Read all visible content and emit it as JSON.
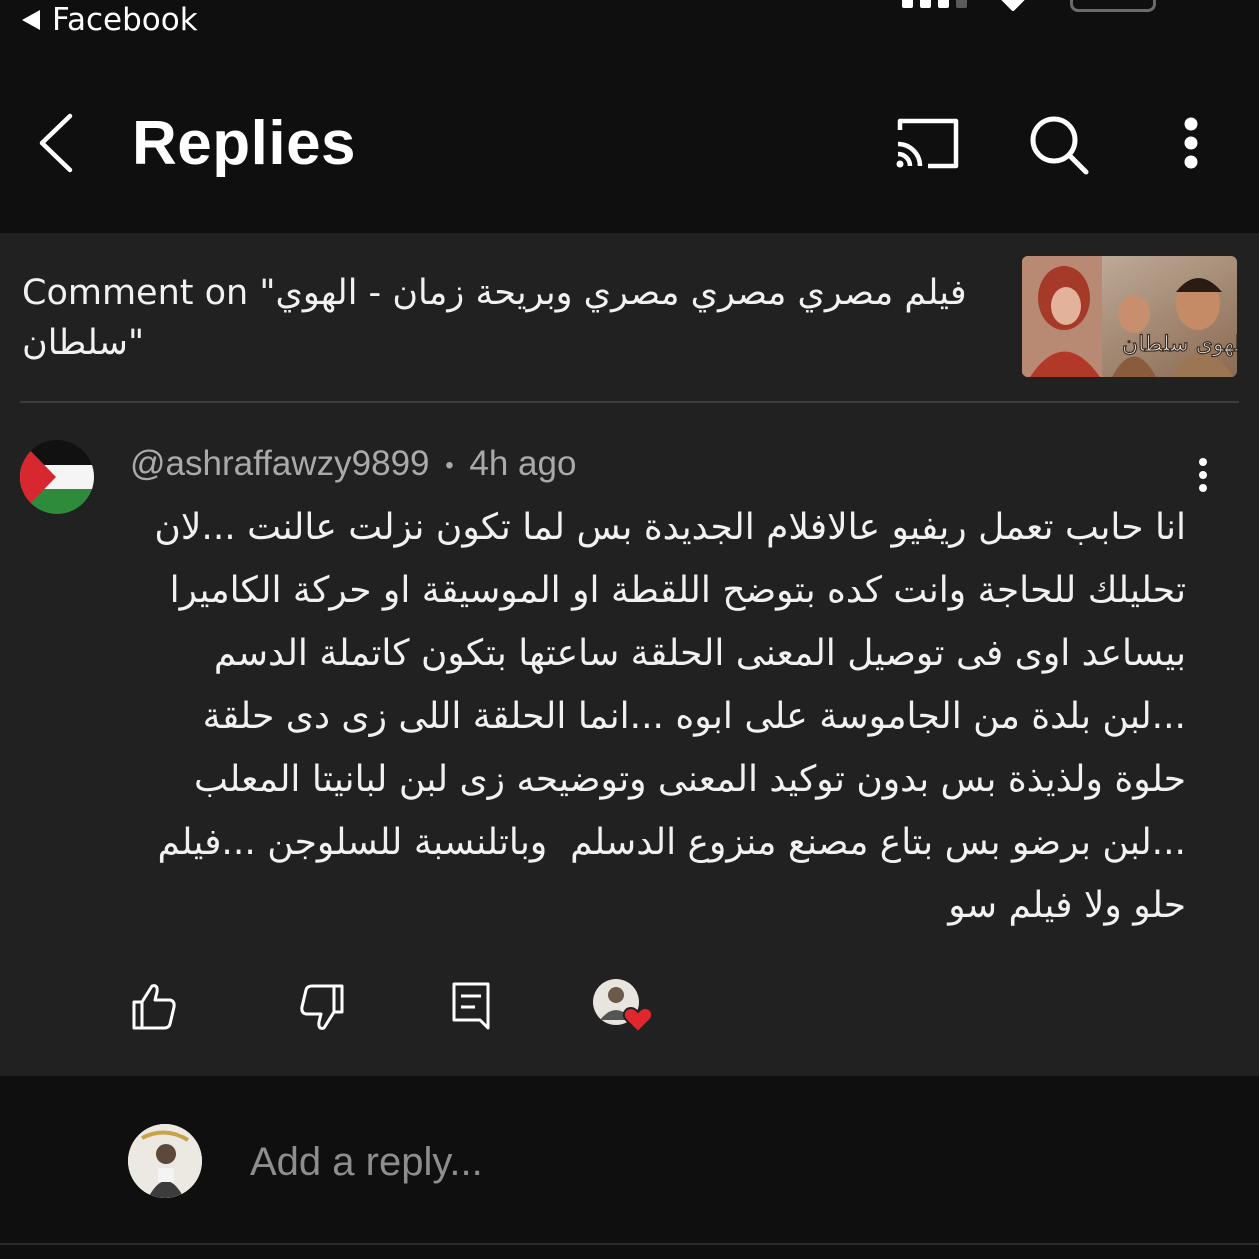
{
  "status_bar": {
    "back_app": "Facebook"
  },
  "app_bar": {
    "title": "Replies",
    "icons": [
      "back-icon",
      "cast-icon",
      "search-icon",
      "more-vert-icon"
    ]
  },
  "video": {
    "title": "Comment on \"فيلم مصري مصري مصري وبريحة زمان - الهوي سلطان\"",
    "thumbnail_text": "الهوى سلطان"
  },
  "comment": {
    "author": "@ashraffawzy9899",
    "separator": "•",
    "time": "4h ago",
    "text": "انا حابب تعمل ريفيو عالافلام الجديدة بس لما تكون نزلت عالنت ...لان تحليلك للحاجة وانت كده بتوضح اللقطة او الموسيقة او حركة الكاميرا بيساعد اوى فى توصيل المعنى الحلقة ساعتها بتكون كاتملة الدسم ...لبن بلدة من الجاموسة على ابوه ...انما الحلقة اللى زى دى حلقة حلوة ولذيذة بس بدون توكيد المعنى وتوضيحه زى لبن لبانيتا المعلب ...لبن برضو بس بتاع مصنع منزوع الدسلم  وباتلنسبة للسلوجن ...فيلم حلو ولا فيلم سو",
    "actions": [
      "like-icon",
      "dislike-icon",
      "reply-icon",
      "creator-heart-icon"
    ]
  },
  "reply_box": {
    "placeholder": "Add a reply..."
  },
  "colors": {
    "background": "#0f0f0f",
    "panel": "#212121",
    "text": "#f1f1f1",
    "muted": "#aaaaaa",
    "heart": "#e0262f"
  }
}
